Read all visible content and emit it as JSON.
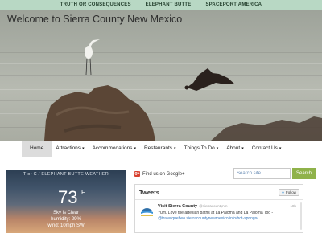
{
  "topbar": {
    "links": [
      "TRUTH OR CONSEQUENCES",
      "ELEPHANT BUTTE",
      "SPACEPORT AMERICA"
    ]
  },
  "hero": {
    "site_title": "Welcome to Sierra County New Mexico"
  },
  "nav": {
    "items": [
      {
        "label": "Home",
        "has_dropdown": false,
        "active": true
      },
      {
        "label": "Attractions",
        "has_dropdown": true
      },
      {
        "label": "Accommodations",
        "has_dropdown": true
      },
      {
        "label": "Restaurants",
        "has_dropdown": true
      },
      {
        "label": "Things To Do",
        "has_dropdown": true
      },
      {
        "label": "About",
        "has_dropdown": true
      },
      {
        "label": "Contact Us",
        "has_dropdown": true
      }
    ],
    "dropdown_glyph": "▾"
  },
  "weather": {
    "title": "T or C / ELEPHANT BUTTE WEATHER",
    "temperature": "73",
    "unit": "F",
    "condition": "Sky is Clear",
    "humidity": "humidity: 29%",
    "wind": "wind: 10mph SW"
  },
  "gplus": {
    "icon": "google-plus-icon",
    "label": "Find us on Google+",
    "icon_glyph": "g+"
  },
  "search": {
    "placeholder": "Search site",
    "button_label": "Search"
  },
  "tweets": {
    "heading": "Tweets",
    "follow_label": "Follow",
    "items": [
      {
        "name": "Visit Sierra County",
        "handle": "@sierracountynm",
        "time": "18h",
        "text": "Yum. Love the artesian baths at La Paloma and La Paloma Too - ",
        "link_text": "@travelquebeo sierracountynewmexico.info/hot-springs/"
      }
    ]
  },
  "colors": {
    "topbar_bg": "#b8d8c4",
    "search_button": "#8fb24a",
    "gplus_red": "#d8402f",
    "twitter_blue": "#3b94d9"
  }
}
